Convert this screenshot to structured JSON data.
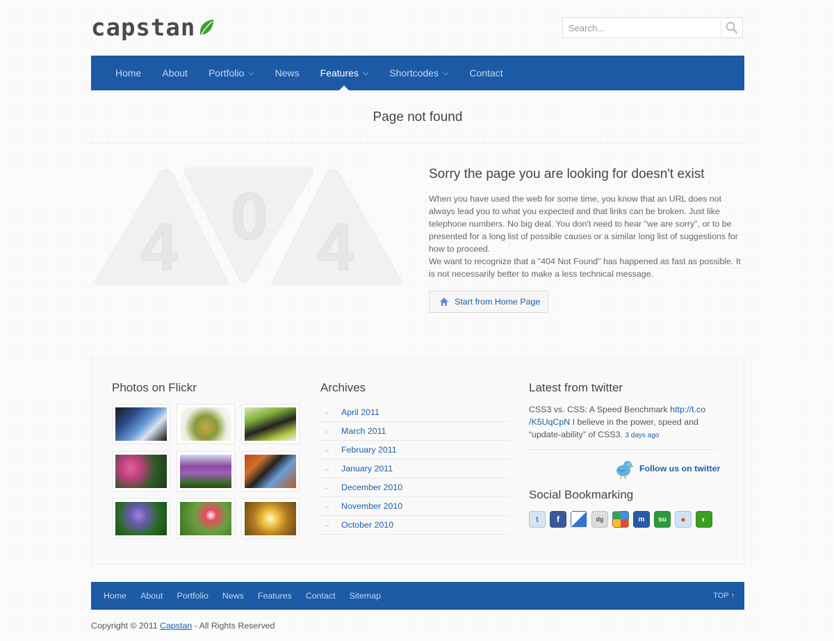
{
  "header": {
    "logo_text": "capstan",
    "search_placeholder": "Search..."
  },
  "nav": {
    "items": [
      {
        "label": "Home",
        "dropdown": false
      },
      {
        "label": "About",
        "dropdown": false
      },
      {
        "label": "Portfolio",
        "dropdown": true
      },
      {
        "label": "News",
        "dropdown": false
      },
      {
        "label": "Features",
        "dropdown": true,
        "active": true
      },
      {
        "label": "Shortcodes",
        "dropdown": true
      },
      {
        "label": "Contact",
        "dropdown": false
      }
    ]
  },
  "page": {
    "title": "Page not found",
    "art_digits": [
      "4",
      "0",
      "4"
    ],
    "error_title": "Sorry the page you are looking for doesn't exist",
    "error_p1": "When you have used the web for some time, you know that an URL does not always lead you to what you expected and that links can be broken. Just like telephone numbers. No big deal. You don't need to hear \"we are sorry\", or to be presented for a long list of possible causes or a similar long list of suggestions for how to proceed.",
    "error_p2": "We want to recognize that a \"404 Not Found\" has happened as fast as possible. It is not necessarily better to make a less technical message.",
    "home_button": "Start from Home Page"
  },
  "widgets": {
    "flickr_title": "Photos on Flickr",
    "archives_title": "Archives",
    "archives": [
      "April 2011",
      "March 2011",
      "February 2011",
      "January 2011",
      "December 2010",
      "November 2010",
      "October 2010"
    ],
    "twitter_title": "Latest from twitter",
    "tweet_text_1": "CSS3 vs. CSS: A Speed Benchmark ",
    "tweet_link_1": "http://t.co",
    "tweet_link_2": "/K5UqCpN",
    "tweet_text_2": " I believe in the power, speed and “update-ability” of CSS3. ",
    "tweet_ago": "3 days ago",
    "follow_label": "Follow us on twitter",
    "social_title": "Social Bookmarking",
    "social_icons": [
      "twitter-icon",
      "facebook-icon",
      "delicious-icon",
      "digg-icon",
      "google-icon",
      "myspace-icon",
      "stumbleupon-icon",
      "reddit-icon",
      "technorati-icon"
    ]
  },
  "footer": {
    "links": [
      "Home",
      "About",
      "Portfolio",
      "News",
      "Features",
      "Contact",
      "Sitemap"
    ],
    "top_label": "TOP ↑",
    "copyright_prefix": "Copyright © 2011 ",
    "copyright_link": "Capstan",
    "copyright_suffix": " - All Rights Reserved"
  },
  "colors": {
    "nav_bg": "#1d5aa6",
    "link": "#1b5fa8"
  }
}
